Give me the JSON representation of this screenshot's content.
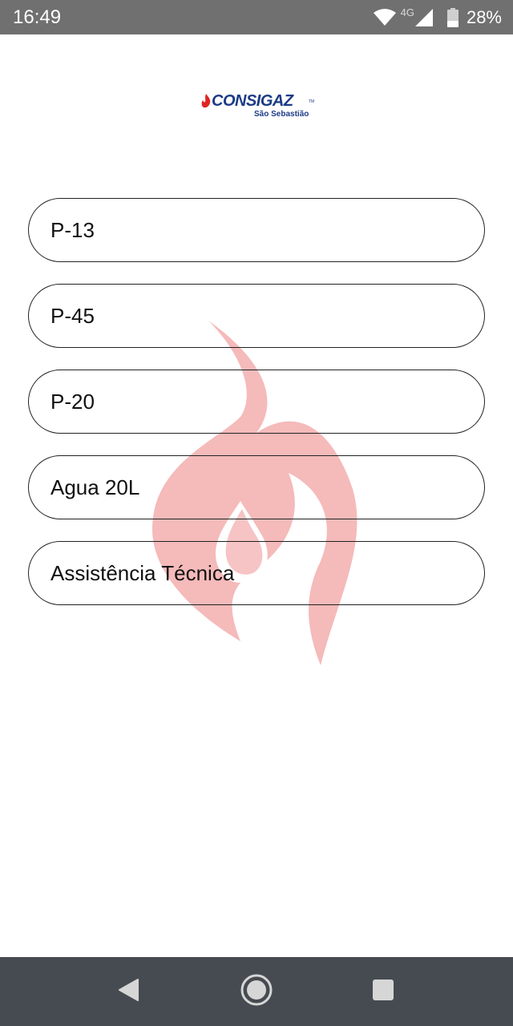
{
  "status_bar": {
    "time": "16:49",
    "network_type": "4G",
    "battery_percent": "28%",
    "icons": [
      "wifi-icon",
      "signal-icon",
      "battery-icon"
    ]
  },
  "header": {
    "logo_text": "CONSIGAZ",
    "logo_tm": "TM",
    "logo_subtitle": "São Sebastião",
    "brand_color": "#1c3b86",
    "flame_color": "#e02424"
  },
  "menu": {
    "items": [
      {
        "label": "P-13"
      },
      {
        "label": "P-45"
      },
      {
        "label": "P-20"
      },
      {
        "label": "Agua 20L"
      },
      {
        "label": "Assistência Técnica"
      }
    ]
  },
  "watermark": {
    "icon": "flame-icon",
    "color": "#f2a3a3"
  },
  "nav_bar": {
    "buttons": [
      "back-icon",
      "home-icon",
      "recents-icon"
    ]
  }
}
